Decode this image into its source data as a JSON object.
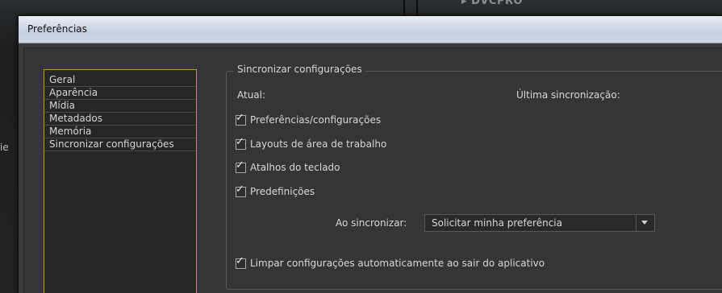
{
  "window": {
    "title": "Preferências"
  },
  "background": {
    "folder_label": "DVCPRO",
    "left_text": "ie"
  },
  "sidebar": {
    "items": [
      {
        "label": "Geral"
      },
      {
        "label": "Aparência"
      },
      {
        "label": "Mídia"
      },
      {
        "label": "Metadados"
      },
      {
        "label": "Memória"
      },
      {
        "label": "Sincronizar configurações"
      }
    ]
  },
  "sync": {
    "group_title": "Sincronizar configurações",
    "current_label": "Atual:",
    "last_sync_label": "Última sincronização:",
    "options": [
      {
        "label": "Preferências/configurações",
        "checked": true
      },
      {
        "label": "Layouts de área de trabalho",
        "checked": true
      },
      {
        "label": "Atalhos do teclado",
        "checked": true
      },
      {
        "label": "Predefinições",
        "checked": true
      }
    ],
    "on_sync_label": "Ao sincronizar:",
    "on_sync_value": "Solicitar minha preferência",
    "auto_clear": {
      "label": "Limpar configurações automaticamente ao sair do aplicativo",
      "checked": true
    }
  },
  "icons": {
    "check": "✓",
    "dropdown": "chevron-down-icon",
    "folder": "folder-triangle-icon"
  },
  "colors": {
    "list_border": "#c8952a",
    "panel_bg": "#353535",
    "titlebar": "#d2dde8"
  }
}
